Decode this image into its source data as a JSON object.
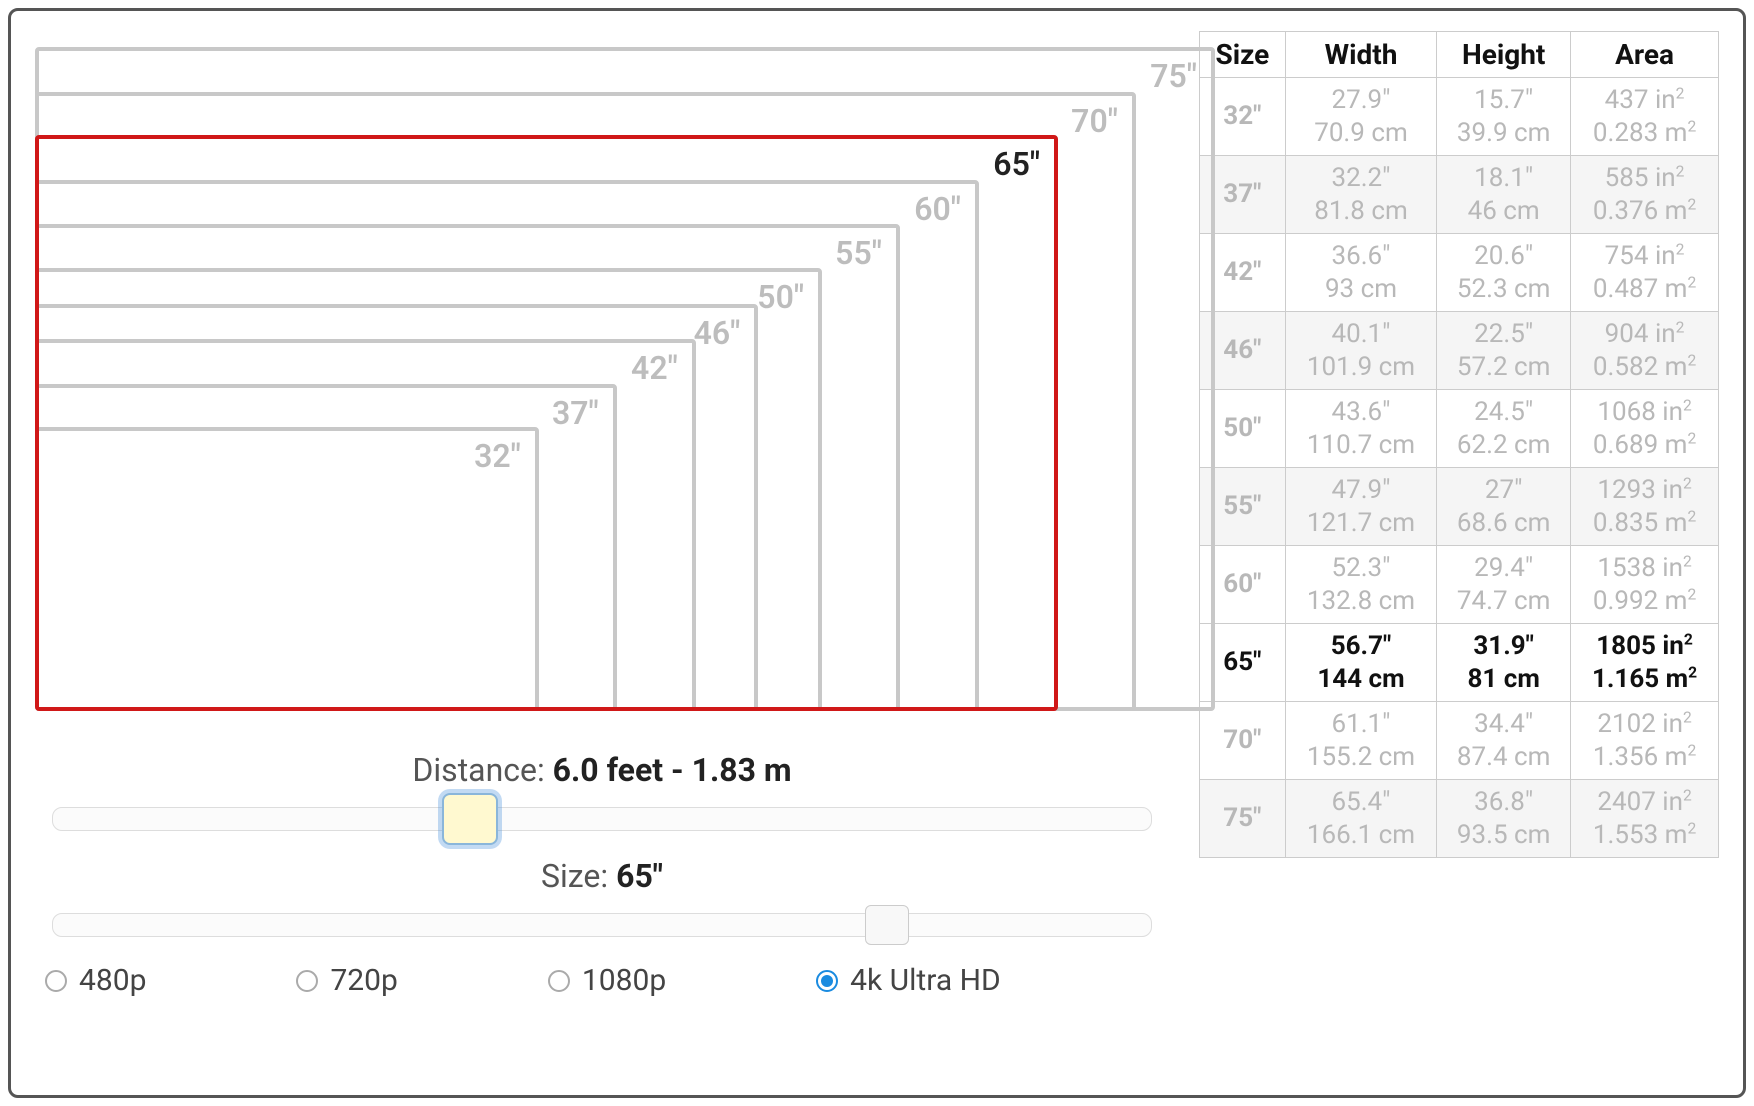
{
  "diagram": {
    "sizes": [
      {
        "label": "32\"",
        "scale": 0.427
      },
      {
        "label": "37\"",
        "scale": 0.493
      },
      {
        "label": "42\"",
        "scale": 0.56
      },
      {
        "label": "46\"",
        "scale": 0.613
      },
      {
        "label": "50\"",
        "scale": 0.667
      },
      {
        "label": "55\"",
        "scale": 0.733
      },
      {
        "label": "60\"",
        "scale": 0.8
      },
      {
        "label": "65\"",
        "scale": 0.867,
        "selected": true
      },
      {
        "label": "70\"",
        "scale": 0.933
      },
      {
        "label": "75\"",
        "scale": 1.0
      }
    ]
  },
  "controls": {
    "distance_label_prefix": "Distance: ",
    "distance_value": "6.0 feet - 1.83 m",
    "distance_slider_pct": 38,
    "size_label_prefix": "Size: ",
    "size_value": "65\"",
    "size_slider_pct": 76,
    "resolutions": [
      {
        "label": "480p",
        "checked": false
      },
      {
        "label": "720p",
        "checked": false
      },
      {
        "label": "1080p",
        "checked": false
      },
      {
        "label": "4k Ultra HD",
        "checked": true
      }
    ]
  },
  "table": {
    "headers": [
      "Size",
      "Width",
      "Height",
      "Area"
    ],
    "rows": [
      {
        "size": "32\"",
        "width_in": "27.9\"",
        "width_cm": "70.9 cm",
        "height_in": "15.7\"",
        "height_cm": "39.9 cm",
        "area_in": "437 in²",
        "area_m": "0.283 m²",
        "stripe": false,
        "selected": false
      },
      {
        "size": "37\"",
        "width_in": "32.2\"",
        "width_cm": "81.8 cm",
        "height_in": "18.1\"",
        "height_cm": "46 cm",
        "area_in": "585 in²",
        "area_m": "0.376 m²",
        "stripe": true,
        "selected": false
      },
      {
        "size": "42\"",
        "width_in": "36.6\"",
        "width_cm": "93 cm",
        "height_in": "20.6\"",
        "height_cm": "52.3 cm",
        "area_in": "754 in²",
        "area_m": "0.487 m²",
        "stripe": false,
        "selected": false
      },
      {
        "size": "46\"",
        "width_in": "40.1\"",
        "width_cm": "101.9 cm",
        "height_in": "22.5\"",
        "height_cm": "57.2 cm",
        "area_in": "904 in²",
        "area_m": "0.582 m²",
        "stripe": true,
        "selected": false
      },
      {
        "size": "50\"",
        "width_in": "43.6\"",
        "width_cm": "110.7 cm",
        "height_in": "24.5\"",
        "height_cm": "62.2 cm",
        "area_in": "1068 in²",
        "area_m": "0.689 m²",
        "stripe": false,
        "selected": false
      },
      {
        "size": "55\"",
        "width_in": "47.9\"",
        "width_cm": "121.7 cm",
        "height_in": "27\"",
        "height_cm": "68.6 cm",
        "area_in": "1293 in²",
        "area_m": "0.835 m²",
        "stripe": true,
        "selected": false
      },
      {
        "size": "60\"",
        "width_in": "52.3\"",
        "width_cm": "132.8 cm",
        "height_in": "29.4\"",
        "height_cm": "74.7 cm",
        "area_in": "1538 in²",
        "area_m": "0.992 m²",
        "stripe": false,
        "selected": false
      },
      {
        "size": "65\"",
        "width_in": "56.7\"",
        "width_cm": "144 cm",
        "height_in": "31.9\"",
        "height_cm": "81 cm",
        "area_in": "1805 in²",
        "area_m": "1.165 m²",
        "stripe": false,
        "selected": true
      },
      {
        "size": "70\"",
        "width_in": "61.1\"",
        "width_cm": "155.2 cm",
        "height_in": "34.4\"",
        "height_cm": "87.4 cm",
        "area_in": "2102 in²",
        "area_m": "1.356 m²",
        "stripe": false,
        "selected": false
      },
      {
        "size": "75\"",
        "width_in": "65.4\"",
        "width_cm": "166.1 cm",
        "height_in": "36.8\"",
        "height_cm": "93.5 cm",
        "area_in": "2407 in²",
        "area_m": "1.553 m²",
        "stripe": true,
        "selected": false
      }
    ]
  }
}
